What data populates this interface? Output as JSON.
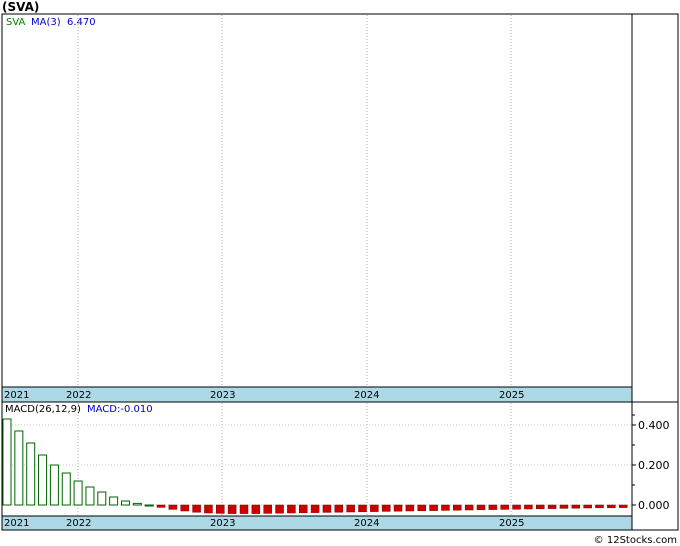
{
  "title": "(SVA)",
  "watermark": "© 12Stocks.com",
  "colors": {
    "axis_band": "#add8e6",
    "ma_text": "#0000cc",
    "sva_text": "#008000",
    "bar_positive": "#006400",
    "bar_negative": "#cc0000",
    "grid": "#c0c0c0"
  },
  "chart_data": [
    {
      "type": "line",
      "legend": {
        "symbol": "SVA",
        "ma_label": "MA(3)",
        "ma_value": "6.470"
      },
      "x_ticks": [
        "2021",
        "2022",
        "2023",
        "2024",
        "2025"
      ],
      "series": [],
      "grid": true
    },
    {
      "type": "bar",
      "legend": {
        "label": "MACD(26,12,9)",
        "macd_label": "MACD:-0.010"
      },
      "x_ticks": [
        "2021",
        "2022",
        "2023",
        "2024",
        "2025"
      ],
      "y_ticks": [
        "0.400",
        "0.200",
        "0.000"
      ],
      "ylim": [
        -0.06,
        0.48
      ],
      "values": [
        0.43,
        0.37,
        0.31,
        0.25,
        0.2,
        0.16,
        0.12,
        0.09,
        0.065,
        0.04,
        0.02,
        0.008,
        0.0,
        -0.012,
        -0.022,
        -0.03,
        -0.036,
        -0.04,
        -0.042,
        -0.043,
        -0.043,
        -0.043,
        -0.042,
        -0.041,
        -0.04,
        -0.039,
        -0.038,
        -0.037,
        -0.036,
        -0.035,
        -0.034,
        -0.033,
        -0.032,
        -0.031,
        -0.03,
        -0.029,
        -0.028,
        -0.027,
        -0.026,
        -0.025,
        -0.024,
        -0.023,
        -0.022,
        -0.021,
        -0.02,
        -0.019,
        -0.018,
        -0.017,
        -0.016,
        -0.015,
        -0.014,
        -0.014,
        -0.013
      ]
    }
  ]
}
